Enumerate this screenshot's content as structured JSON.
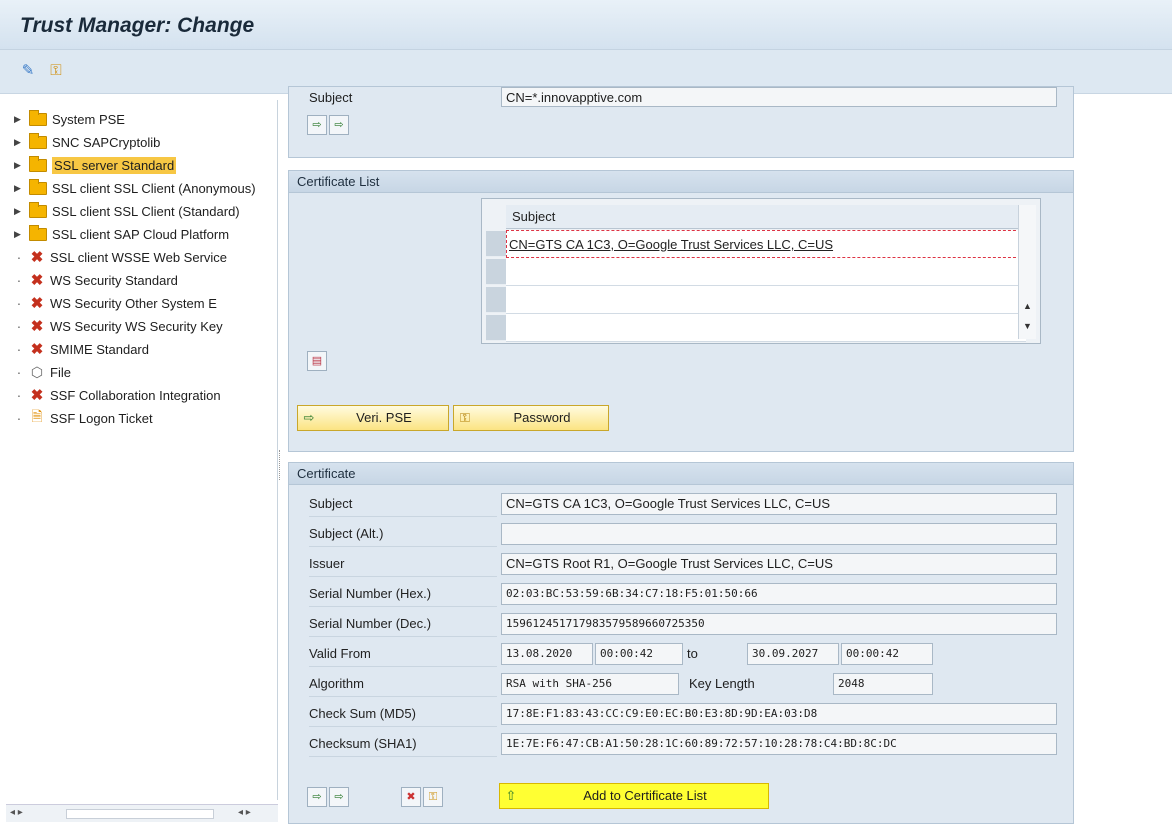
{
  "window": {
    "title": "Trust Manager: Change"
  },
  "toolbar": {
    "icons": [
      "display-change-icon",
      "key-icon"
    ]
  },
  "tree": {
    "items": [
      {
        "label": "System PSE",
        "icon": "folder",
        "expand": true
      },
      {
        "label": "SNC SAPCryptolib",
        "icon": "folder",
        "expand": true
      },
      {
        "label": "SSL server Standard",
        "icon": "folder",
        "expand": true,
        "selected": true
      },
      {
        "label": "SSL client SSL Client (Anonymous)",
        "icon": "folder",
        "expand": true
      },
      {
        "label": "SSL client SSL Client (Standard)",
        "icon": "folder",
        "expand": true
      },
      {
        "label": "SSL client SAP Cloud Platform",
        "icon": "folder",
        "expand": true
      },
      {
        "label": "SSL client WSSE Web Service",
        "icon": "x",
        "expand": false
      },
      {
        "label": "WS Security Standard",
        "icon": "x",
        "expand": false
      },
      {
        "label": "WS Security Other System E",
        "icon": "x",
        "expand": false
      },
      {
        "label": "WS Security WS Security Key",
        "icon": "x",
        "expand": false
      },
      {
        "label": "SMIME Standard",
        "icon": "x",
        "expand": false
      },
      {
        "label": "File",
        "icon": "file",
        "expand": false
      },
      {
        "label": "SSF Collaboration Integration",
        "icon": "x",
        "expand": false
      },
      {
        "label": "SSF Logon Ticket",
        "icon": "ticket",
        "expand": false
      }
    ]
  },
  "owner_panel": {
    "subject_label": "Subject",
    "subject_value": "CN=*.innovapptive.com"
  },
  "cert_list": {
    "heading": "Certificate List",
    "column": "Subject",
    "rows": [
      "CN=GTS CA 1C3, O=Google Trust Services LLC, C=US",
      "",
      "",
      ""
    ],
    "veri_button": "Veri. PSE",
    "password_button": "Password"
  },
  "certificate": {
    "heading": "Certificate",
    "labels": {
      "subject": "Subject",
      "subject_alt": "Subject (Alt.)",
      "issuer": "Issuer",
      "serial_hex": "Serial Number (Hex.)",
      "serial_dec": "Serial Number (Dec.)",
      "valid_from": "Valid From",
      "valid_to": "to",
      "algorithm": "Algorithm",
      "key_length": "Key Length",
      "md5": "Check Sum (MD5)",
      "sha1": "Checksum (SHA1)"
    },
    "values": {
      "subject": "CN=GTS CA 1C3, O=Google Trust Services LLC, C=US",
      "subject_alt": "",
      "issuer": "CN=GTS Root R1, O=Google Trust Services LLC, C=US",
      "serial_hex": "02:03:BC:53:59:6B:34:C7:18:F5:01:50:66",
      "serial_dec": "159612451717983579589660725350",
      "valid_from_date": "13.08.2020",
      "valid_from_time": "00:00:42",
      "valid_to_date": "30.09.2027",
      "valid_to_time": "00:00:42",
      "algorithm": "RSA with SHA-256",
      "key_length": "2048",
      "md5": "17:8E:F1:83:43:CC:C9:E0:EC:B0:E3:8D:9D:EA:03:D8",
      "sha1": "1E:7E:F6:47:CB:A1:50:28:1C:60:89:72:57:10:28:78:C4:BD:8C:DC"
    },
    "add_button": "Add to Certificate List"
  }
}
